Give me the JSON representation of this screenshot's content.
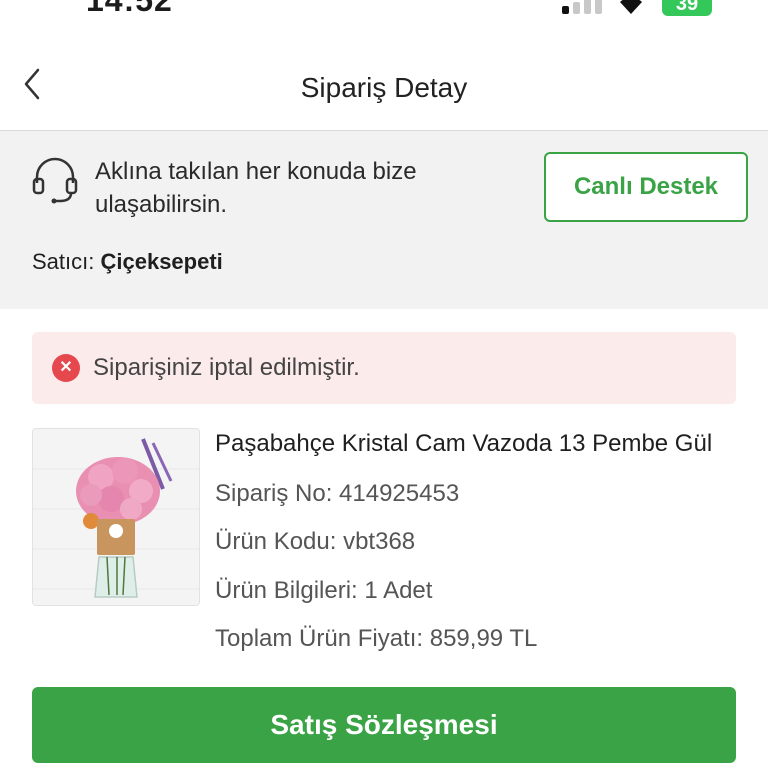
{
  "status_bar": {
    "time": "14:52",
    "battery": "39"
  },
  "header": {
    "title": "Sipariş Detay"
  },
  "support": {
    "message": "Aklına takılan her konuda bize ulaşabilirsin.",
    "button_label": "Canlı Destek",
    "seller_label": "Satıcı:",
    "seller_name": "Çiçeksepeti"
  },
  "order_status": {
    "message": "Siparişiniz iptal edilmiştir.",
    "icon": "close-icon"
  },
  "product": {
    "name": "Paşabahçe Kristal Cam Vazoda 13 Pembe Gül",
    "order_no": "Sipariş No: 414925453",
    "code": "Ürün Kodu: vbt368",
    "details": "Ürün Bilgileri: 1 Adet",
    "total": "Toplam Ürün Fiyatı: 859,99 TL"
  },
  "actions": {
    "contract_label": "Satış Sözleşmesi"
  },
  "colors": {
    "accent": "#3aa346",
    "alert_bg": "#fcebeb",
    "alert_icon": "#e5484d"
  }
}
